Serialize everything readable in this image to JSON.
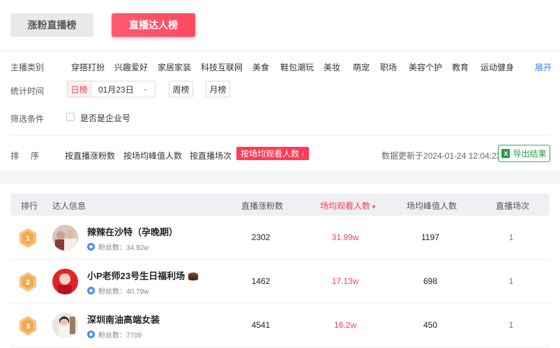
{
  "tabs": [
    {
      "label": "涨粉直播榜",
      "active": false
    },
    {
      "label": "直播达人榜",
      "active": true
    }
  ],
  "filters": {
    "category_label": "主播类别",
    "categories": [
      "穿搭打扮",
      "兴趣爱好",
      "家居家装",
      "科技互联网",
      "美食",
      "鞋包潮玩",
      "美妆",
      "萌宠",
      "职场",
      "美容个护",
      "教育",
      "运动健身"
    ],
    "expand_label": "展开",
    "time_label": "统计时间",
    "day_label": "日榜",
    "date_value": "01月23日",
    "week_label": "周榜",
    "month_label": "月榜",
    "condition_label": "筛选条件",
    "enterprise_label": "是否是企业号"
  },
  "sort": {
    "label_1": "排",
    "label_2": "序",
    "options": [
      "按直播涨粉数",
      "按场均峰值人数",
      "按直播场次"
    ],
    "active": "按场均观看人数",
    "update_time": "数据更新于2024-01-24 12:04:23",
    "export_label": "导出结果"
  },
  "table": {
    "headers": {
      "rank": "排行",
      "info": "达人信息",
      "fans_gain": "直播涨粉数",
      "avg_view": "场均观看人数",
      "avg_peak": "场均峰值人数",
      "sessions": "直播场次"
    },
    "fans_prefix": "粉丝数：",
    "rows": [
      {
        "rank": "1",
        "name": "辣辣在沙特（孕晚期）",
        "fans": "34.92w",
        "fans_gain": "2302",
        "avg_view": "31.99w",
        "avg_peak": "1197",
        "sessions": "1"
      },
      {
        "rank": "2",
        "name": "小P老师23号生日福利场",
        "fans": "40.79w",
        "fans_gain": "1462",
        "avg_view": "17.13w",
        "avg_peak": "698",
        "sessions": "1"
      },
      {
        "rank": "3",
        "name": "深圳南油高端女装",
        "fans": "7709",
        "fans_gain": "4541",
        "avg_view": "16.2w",
        "avg_peak": "450",
        "sessions": "1"
      }
    ]
  },
  "colors": {
    "accent": "#ff3b55",
    "link": "#3b7bff",
    "export": "#2c9a48",
    "badge_gold": "#f5b453"
  }
}
